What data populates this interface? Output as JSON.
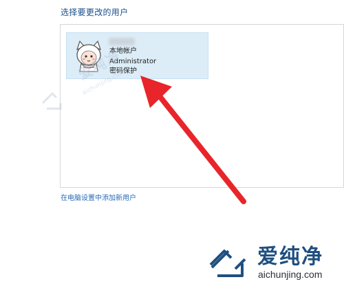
{
  "section": {
    "title": "选择要更改的用户"
  },
  "user_card": {
    "account_type": "本地帐户",
    "account_name": "Administrator",
    "password_status": "密码保护"
  },
  "add_user_link": "在电脑设置中添加新用户",
  "watermark": {
    "cn": "爱纯净",
    "url": "aichunjing.com"
  },
  "colors": {
    "title": "#1a4f8a",
    "link": "#2a6bb7",
    "card_bg": "#dcedf8",
    "arrow": "#e8252a"
  },
  "icons": [
    "user-avatar-icon",
    "red-arrow-annotation",
    "aichunjing-logo-icon"
  ]
}
